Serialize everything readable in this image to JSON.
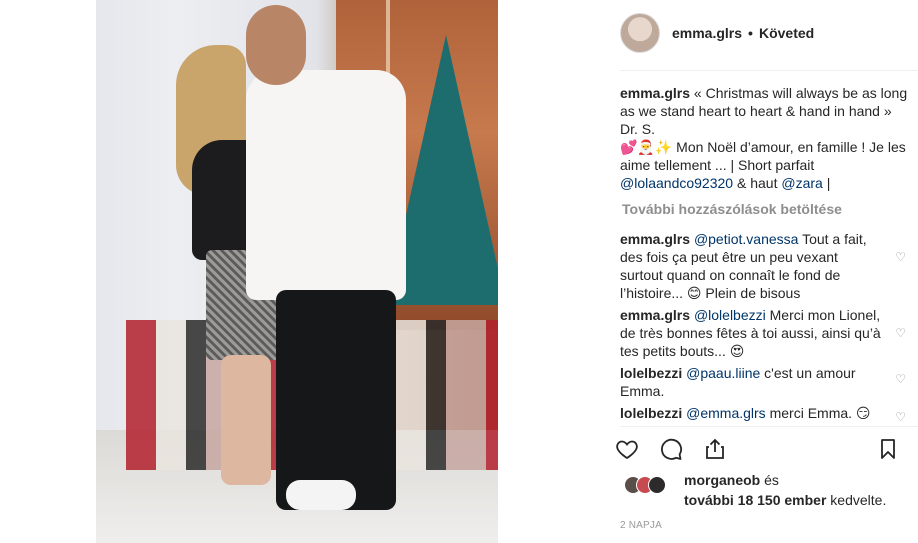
{
  "post_photo": {
    "description_icon": "photo-image"
  },
  "header": {
    "username": "emma.glrs",
    "separator": "•",
    "follow_status": "Követed"
  },
  "caption": {
    "username": "emma.glrs",
    "text1": " « Christmas will always be as long as we stand heart to heart & hand in hand » Dr. S.",
    "emoji": "💕🎅✨",
    "text2": " Mon Noël d’amour, en famille ! Je les aime tellement ... | Short parfait ",
    "mention1": "@lolaandco92320",
    "text3": " & haut ",
    "mention2": "@zara",
    "text4": " |"
  },
  "load_more": "További hozzászólások betöltése",
  "comments": [
    {
      "username": "emma.glrs",
      "mention": "@petiot.vanessa",
      "text": " Tout a fait, des fois ça peut être un peu vexant surtout quand on connaît le fond de l’histoire... 😊  Plein de bisous"
    },
    {
      "username": "emma.glrs",
      "mention": "@lolelbezzi",
      "text": " Merci mon Lionel, de très bonnes fêtes à toi aussi, ainsi qu’à tes petits bouts... 😍"
    },
    {
      "username": "lolelbezzi",
      "mention": "@paau.liine",
      "text": " c'est un amour Emma."
    },
    {
      "username": "lolelbezzi",
      "mention": "@emma.glrs",
      "text": " merci Emma. 😏"
    }
  ],
  "likes": {
    "liker": "morganeob",
    "conj": " és",
    "others": "további 18 150 ember",
    "suffix": " kedvelte."
  },
  "date": "2 NAPJA",
  "icons": {
    "like": "heart-outline-icon",
    "comment": "comment-bubble-icon",
    "share": "share-upload-icon",
    "save": "bookmark-icon"
  }
}
